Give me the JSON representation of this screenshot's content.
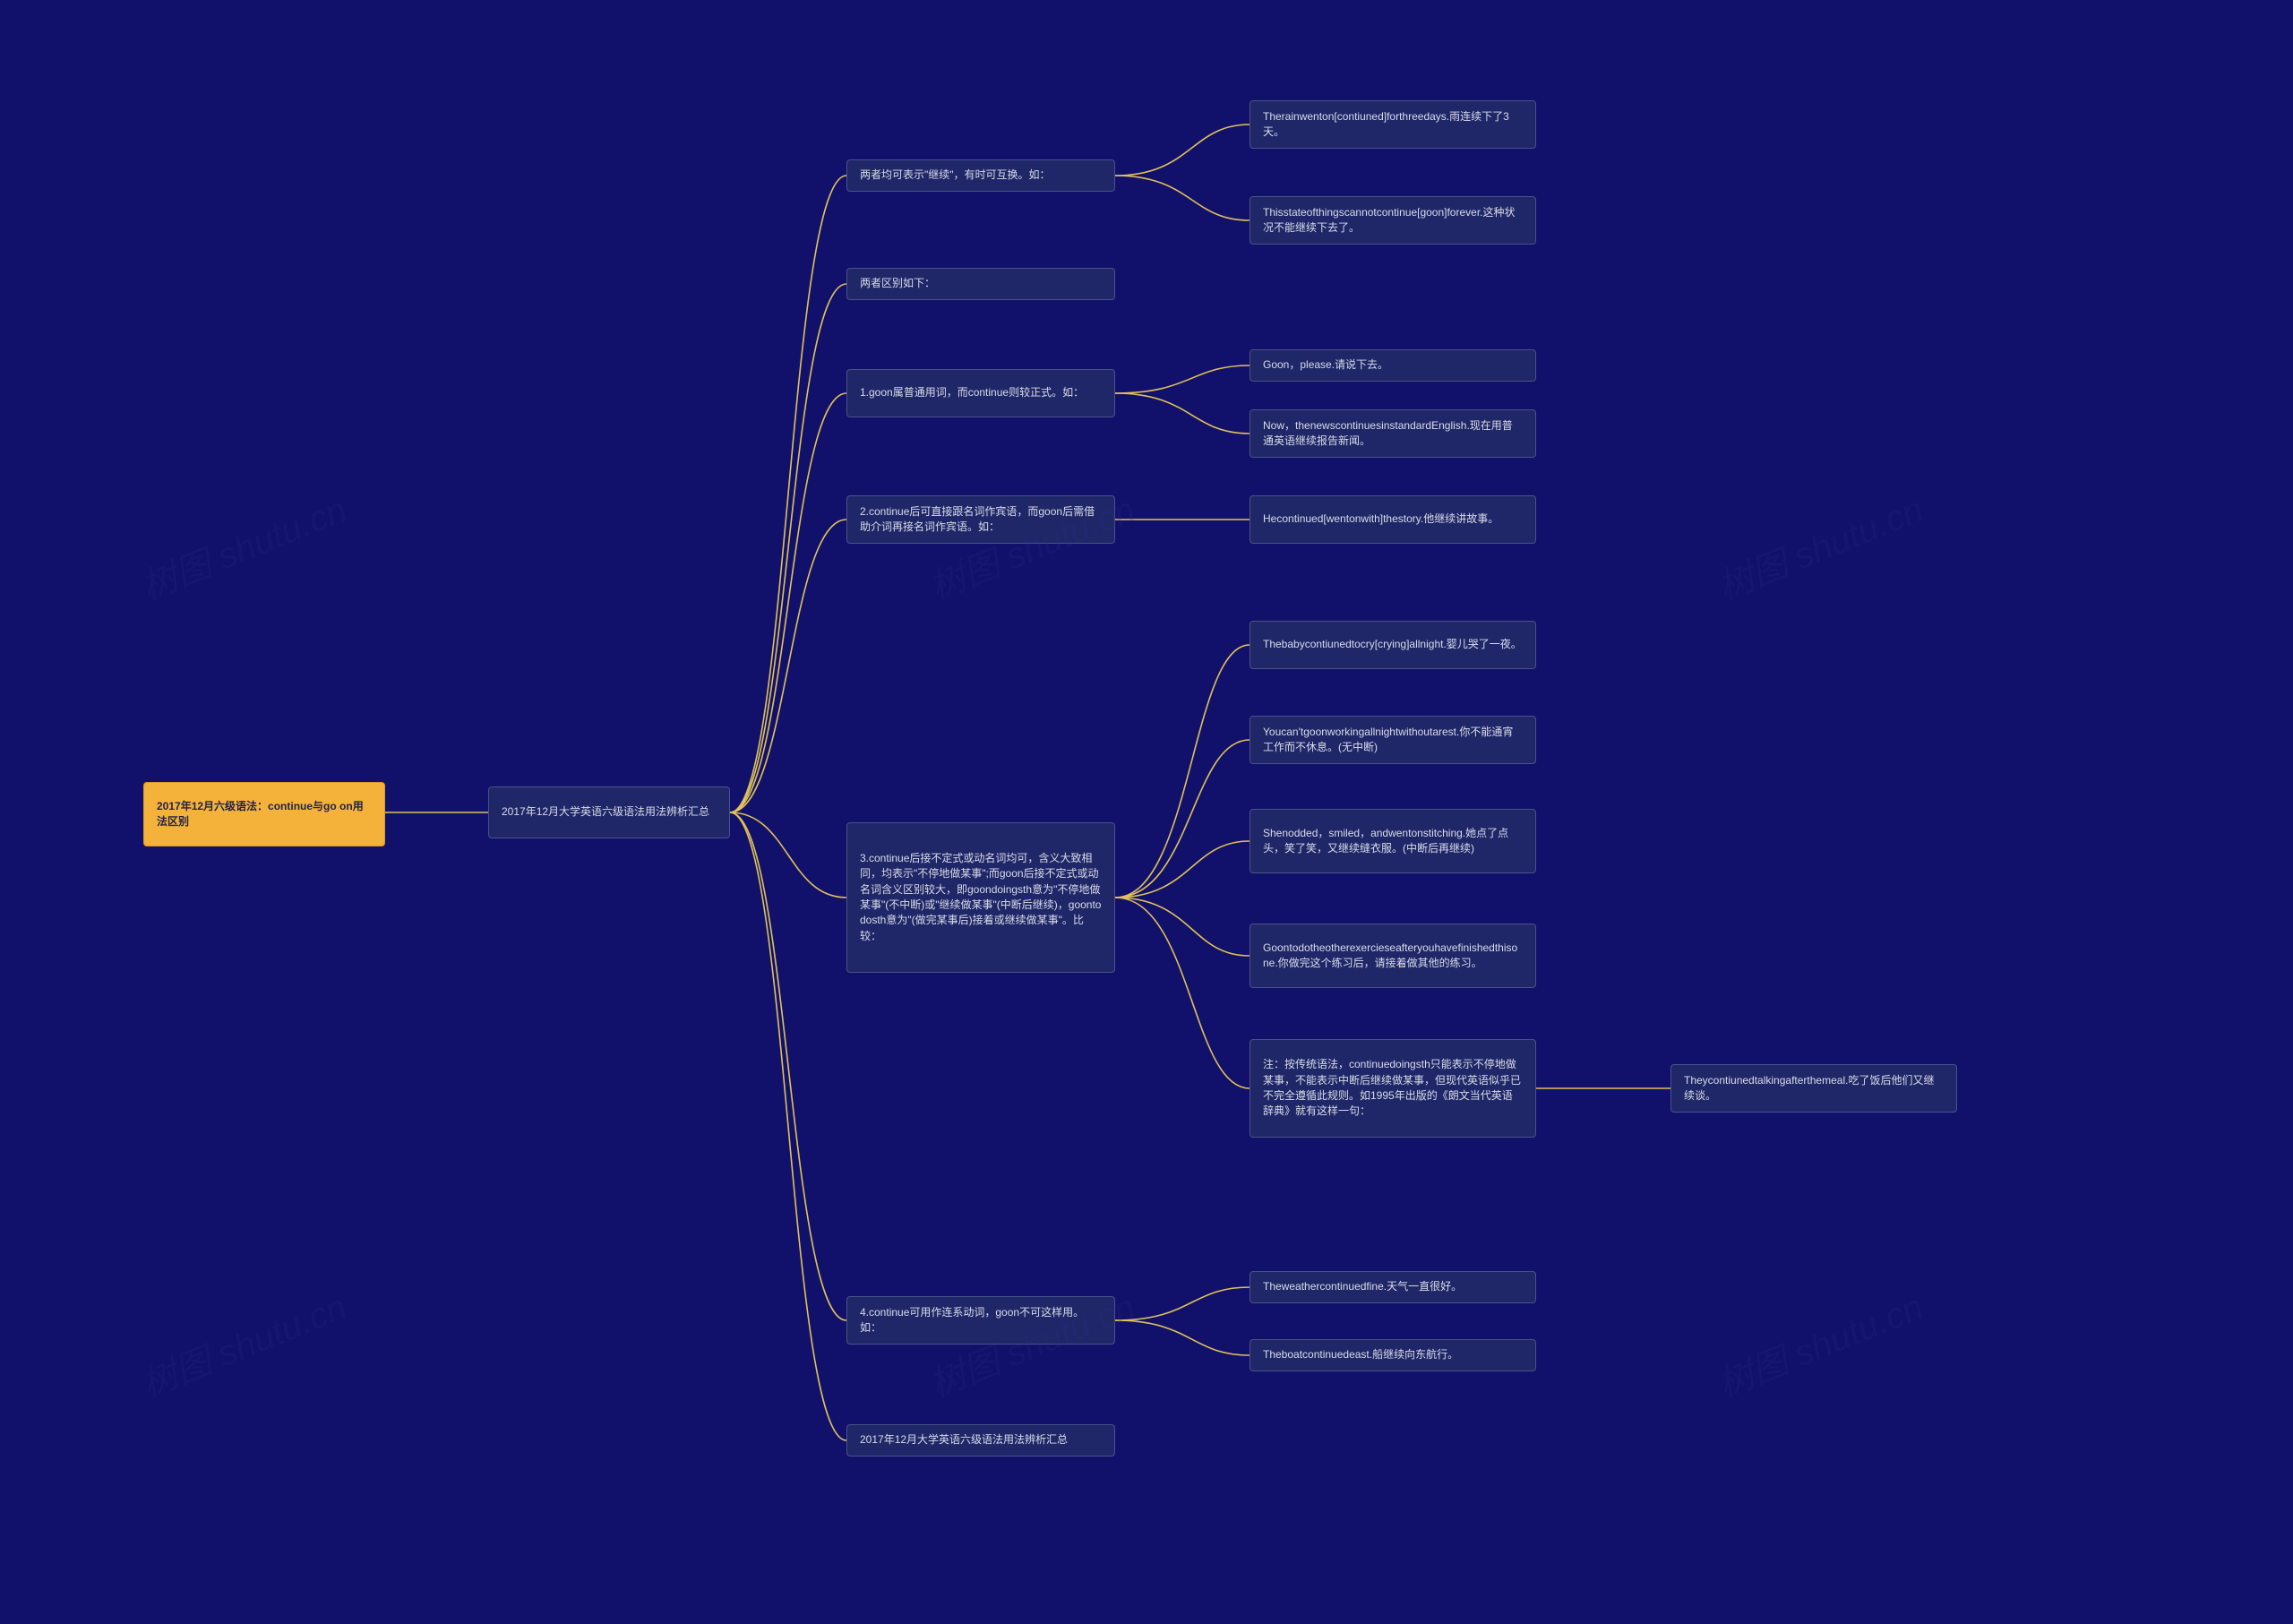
{
  "watermark": "树图 shutu.cn",
  "root": {
    "text": "2017年12月六级语法：continue与go on用法区别"
  },
  "l1": {
    "text": "2017年12月大学英语六级语法用法辨析汇总"
  },
  "c0": {
    "text": "两者均可表示\"继续\"，有时可互换。如："
  },
  "c0a": {
    "text": "Therainwenton[contiuned]forthreedays.雨连续下了3天。"
  },
  "c0b": {
    "text": "Thisstateofthingscannotcontinue[goon]forever.这种状况不能继续下去了。"
  },
  "c1": {
    "text": "两者区别如下："
  },
  "c2": {
    "text": "1.goon属普通用词，而continue则较正式。如："
  },
  "c2a": {
    "text": "Goon，please.请说下去。"
  },
  "c2b": {
    "text": "Now，thenewscontinuesinstandardEnglish.现在用普通英语继续报告新闻。"
  },
  "c3": {
    "text": "2.continue后可直接跟名词作宾语，而goon后需借助介词再接名词作宾语。如："
  },
  "c3a": {
    "text": "Hecontinued[wentonwith]thestory.他继续讲故事。"
  },
  "c4": {
    "text": "3.continue后接不定式或动名词均可，含义大致相同，均表示\"不停地做某事\";而goon后接不定式或动名词含义区别较大，即goondoingsth意为\"不停地做某事\"(不中断)或\"继续做某事\"(中断后继续)，goontodosth意为\"(做完某事后)接着或继续做某事\"。比较："
  },
  "c4a": {
    "text": "Thebabycontiunedtocry[crying]allnight.婴儿哭了一夜。"
  },
  "c4b": {
    "text": "Youcan'tgoonworkingallnightwithoutarest.你不能通宵工作而不休息。(无中断)"
  },
  "c4c": {
    "text": "Shenodded，smiled，andwentonstitching.她点了点头，笑了笑，又继续缝衣服。(中断后再继续)"
  },
  "c4d": {
    "text": "Goontodotheotherexercieseafteryouhavefinishedthisone.你做完这个练习后，请接着做其他的练习。"
  },
  "c4e": {
    "text": "注：按传统语法，continuedoingsth只能表示不停地做某事，不能表示中断后继续做某事，但现代英语似乎已不完全遵循此规则。如1995年出版的《朗文当代英语辞典》就有这样一句："
  },
  "c4e1": {
    "text": "Theycontiunedtalkingafterthemeal.吃了饭后他们又继续谈。"
  },
  "c5": {
    "text": "4.continue可用作连系动词，goon不可这样用。如："
  },
  "c5a": {
    "text": "Theweathercontinuedfine.天气一直很好。"
  },
  "c5b": {
    "text": "Theboatcontinuedeast.船继续向东航行。"
  },
  "c6": {
    "text": "2017年12月大学英语六级语法用法辨析汇总"
  }
}
